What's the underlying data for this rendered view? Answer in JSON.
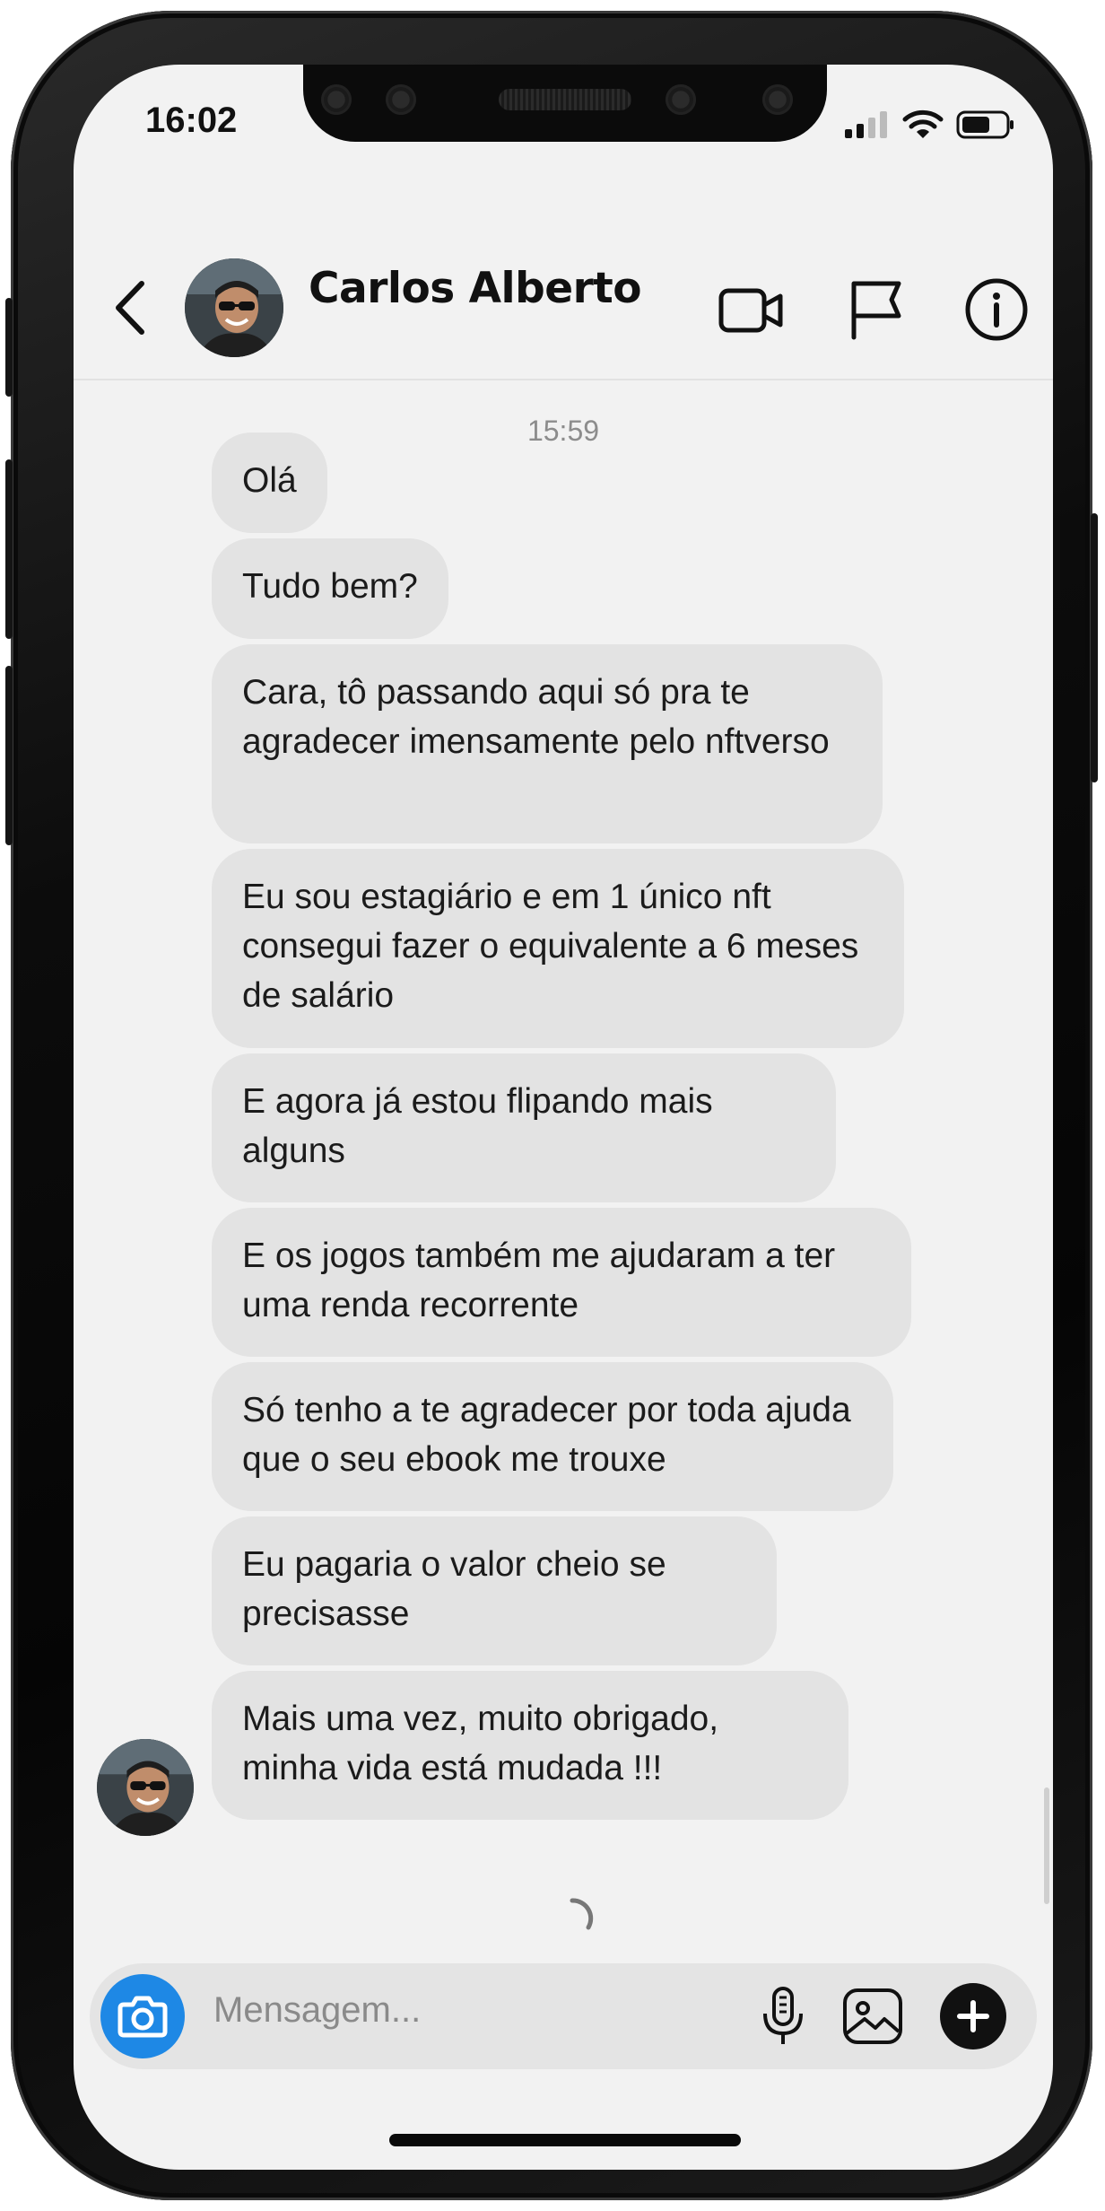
{
  "status_bar": {
    "time": "16:02"
  },
  "header": {
    "contact_name": "Carlos Alberto"
  },
  "conversation": {
    "timestamp": "15:59",
    "messages": [
      {
        "text": "Olá"
      },
      {
        "text": "Tudo bem?"
      },
      {
        "text": "Cara, tô passando aqui só pra te agradecer imensamente pelo nftverso"
      },
      {
        "text": "Eu sou estagiário e em 1 único nft consegui fazer o equivalente a 6 meses de salário"
      },
      {
        "text": "E agora já estou flipando mais alguns"
      },
      {
        "text": "E os jogos também me ajudaram a ter uma renda recorrente"
      },
      {
        "text": "Só tenho a te agradecer por toda ajuda que o seu ebook me trouxe"
      },
      {
        "text": "Eu pagaria o valor cheio se precisasse"
      },
      {
        "text": "Mais uma vez, muito obrigado, minha vida está mudada !!!"
      }
    ]
  },
  "composer": {
    "placeholder": "Mensagem..."
  },
  "icons": {
    "back": "chevron-left-icon",
    "video": "video-camera-icon",
    "report": "flag-icon",
    "info": "info-icon",
    "camera": "camera-icon",
    "mic": "microphone-icon",
    "gallery": "image-icon",
    "add": "plus-icon",
    "loading": "spinner-icon"
  },
  "colors": {
    "accent": "#1e88e5",
    "bubble": "#e3e3e3",
    "background": "#f2f2f2"
  }
}
